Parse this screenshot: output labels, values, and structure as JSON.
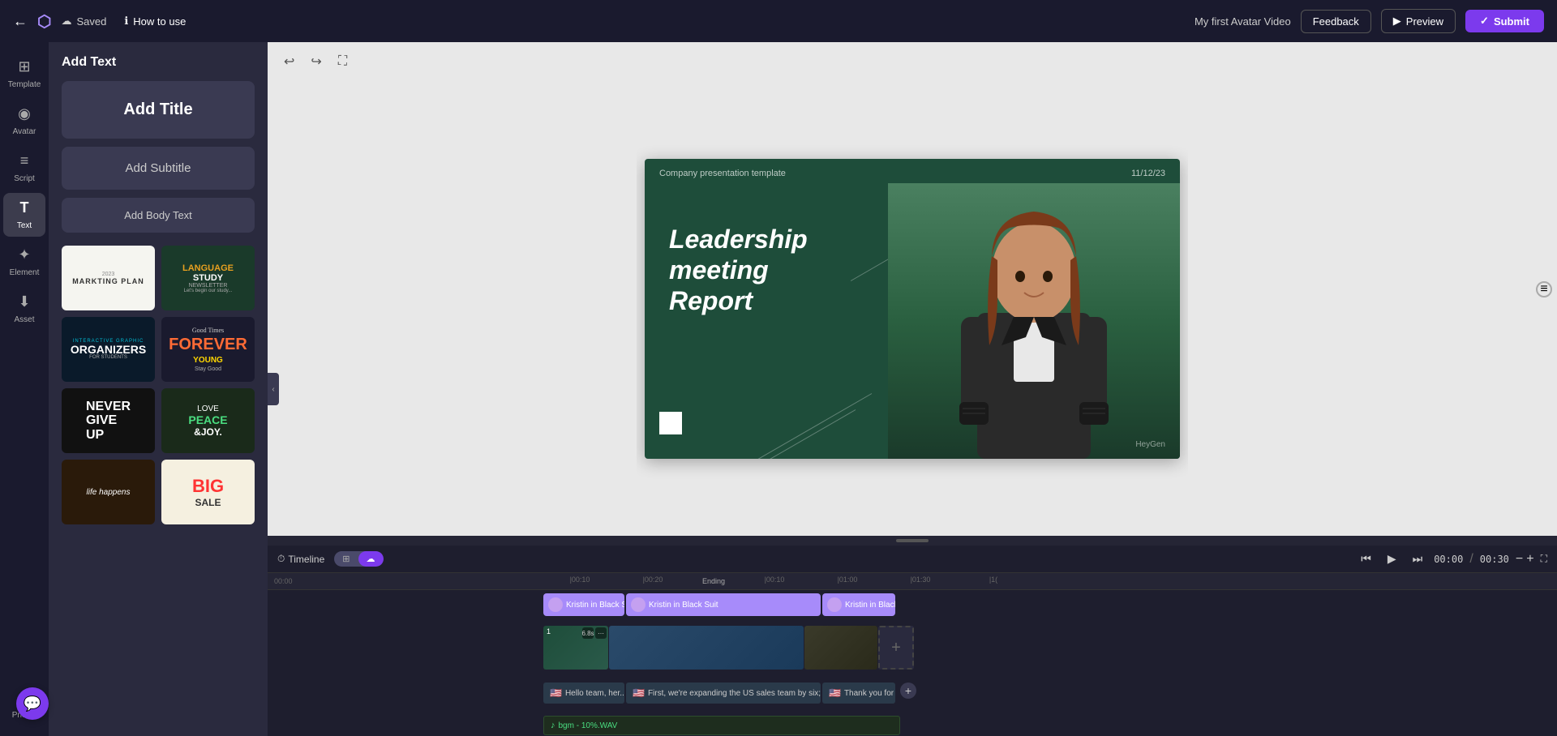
{
  "topbar": {
    "back_icon": "←",
    "logo_icon": "⬡",
    "saved_label": "Saved",
    "how_to_use_label": "How to use",
    "project_name": "My first Avatar Video",
    "feedback_label": "Feedback",
    "preview_label": "Preview",
    "preview_icon": "▶",
    "submit_label": "Submit",
    "submit_icon": "✓"
  },
  "sidebar": {
    "items": [
      {
        "id": "template",
        "icon": "⊞",
        "label": "Template"
      },
      {
        "id": "avatar",
        "icon": "◉",
        "label": "Avatar"
      },
      {
        "id": "script",
        "icon": "≡",
        "label": "Script"
      },
      {
        "id": "text",
        "icon": "T",
        "label": "Text",
        "active": true
      },
      {
        "id": "element",
        "icon": "✦",
        "label": "Element"
      },
      {
        "id": "asset",
        "icon": "⬇",
        "label": "Asset"
      },
      {
        "id": "pricing",
        "icon": "◆",
        "label": "Pricing"
      }
    ]
  },
  "left_panel": {
    "title": "Add Text",
    "add_title_btn": "Add Title",
    "add_subtitle_btn": "Add Subtitle",
    "add_body_btn": "Add Body Text",
    "templates": [
      {
        "id": "tmpl1",
        "style": "tmpl-1",
        "year": "2023",
        "line1": "MARKTING PLAN"
      },
      {
        "id": "tmpl2",
        "style": "tmpl-2",
        "line1": "LANGUAGE",
        "line2": "STUDY",
        "line3": "NEWSLETTER",
        "line4": "Let's begin our study..."
      },
      {
        "id": "tmpl3",
        "style": "tmpl-3",
        "label": "INTERACTIVE GRAPHIC",
        "main": "ORGANIZERS",
        "sub": "FOR STUDENTS"
      },
      {
        "id": "tmpl4",
        "style": "tmpl-4",
        "line1": "Good Times",
        "line2": "FOREVER",
        "line3": "YOUNG",
        "line4": "Stay Good"
      },
      {
        "id": "tmpl5",
        "style": "tmpl-5",
        "line1": "NEVER",
        "line2": "GIVE",
        "line3": "UP"
      },
      {
        "id": "tmpl6",
        "style": "tmpl-6",
        "line1": "LOVE",
        "line2": "PEACE",
        "line3": "&JOY."
      },
      {
        "id": "tmpl7",
        "style": "tmpl-7",
        "line1": "life happens"
      },
      {
        "id": "tmpl8",
        "style": "tmpl-8",
        "line1": "BIG",
        "line2": "SALE"
      }
    ]
  },
  "toolbar": {
    "undo_icon": "↩",
    "redo_icon": "↪",
    "fit_icon": "⛶"
  },
  "slide": {
    "company": "Company presentation template",
    "date": "11/12/23",
    "title_line1": "Leadership meeting",
    "title_line2": "Report",
    "watermark": "HeyGen"
  },
  "timeline": {
    "label": "Timeline",
    "toggle_options": [
      "icon1",
      "icon2"
    ],
    "play_icon": "▶",
    "prev_icon": "⏮",
    "next_icon": "⏭",
    "current_time": "00:00",
    "total_time": "00:30",
    "zoom_minus": "−",
    "zoom_plus": "+",
    "expand_icon": "⛶",
    "ending_label": "Ending",
    "ruler_marks": [
      "00:00",
      "|00:10",
      "|00:20",
      "|0(",
      "|00:10",
      "|01:00",
      "|01:30",
      "|1("
    ],
    "avatar_clips": [
      {
        "label": "Kristin in Black S..."
      },
      {
        "label": "Kristin in Black Suit"
      },
      {
        "label": "Kristin in Black Suit"
      }
    ],
    "scene_count": 1,
    "script_clips": [
      {
        "flag": "🇺🇸",
        "text": "Hello team, her..."
      },
      {
        "flag": "🇺🇸",
        "text": "First, we're expanding the US sales team by six; ..."
      },
      {
        "flag": "🇺🇸",
        "text": "Thank you for you..."
      }
    ],
    "bgm": {
      "icon": "♪",
      "label": "bgm - 10%.WAV"
    },
    "add_scene_icon": "+"
  },
  "chat": {
    "icon": "💬"
  }
}
